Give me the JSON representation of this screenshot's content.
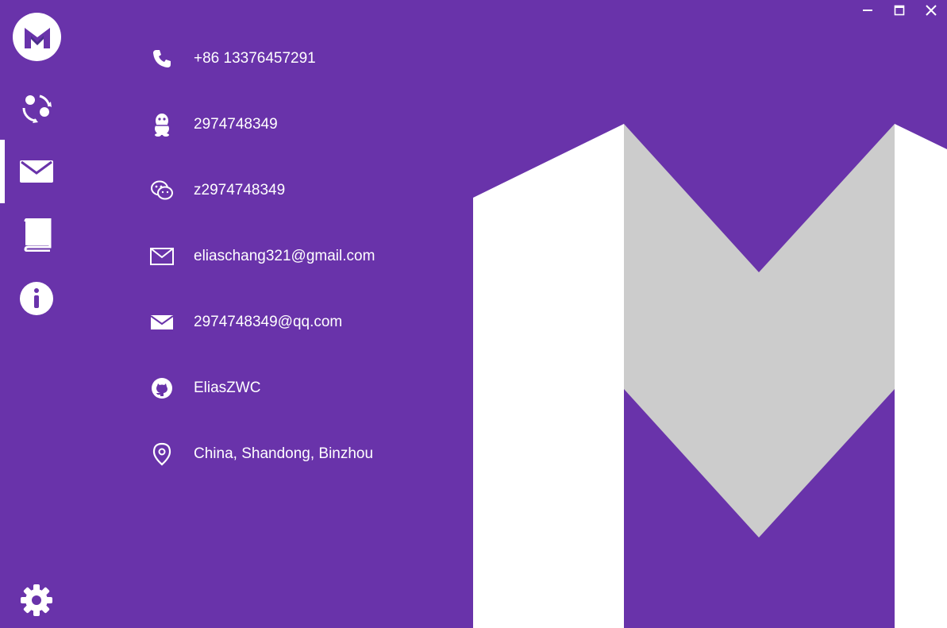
{
  "window": {
    "controls": [
      {
        "name": "minimize-button",
        "icon": "minimize-icon"
      },
      {
        "name": "maximize-button",
        "icon": "maximize-icon"
      },
      {
        "name": "close-button",
        "icon": "close-icon"
      }
    ]
  },
  "sidebar": {
    "logo": {
      "letter": "M",
      "icon": "app-logo-icon"
    },
    "items": [
      {
        "icon": "share-icon",
        "active": false
      },
      {
        "icon": "mail-icon",
        "active": true
      },
      {
        "icon": "book-icon",
        "active": false
      },
      {
        "icon": "info-icon",
        "active": false
      }
    ],
    "bottom": {
      "icon": "gear-icon"
    }
  },
  "contacts": [
    {
      "icon": "phone-icon",
      "text": "+86 13376457291"
    },
    {
      "icon": "qq-penguin-icon",
      "text": "2974748349"
    },
    {
      "icon": "wechat-icon",
      "text": "z2974748349"
    },
    {
      "icon": "envelope-outline-icon",
      "text": "eliaschang321@gmail.com"
    },
    {
      "icon": "envelope-filled-icon",
      "text": "2974748349@qq.com"
    },
    {
      "icon": "github-icon",
      "text": "EliasZWC"
    },
    {
      "icon": "location-pin-icon",
      "text": "China, Shandong, Binzhou"
    }
  ],
  "colors": {
    "background": "#6933aa",
    "foreground": "#ffffff",
    "m_inner": "#cccccc"
  }
}
